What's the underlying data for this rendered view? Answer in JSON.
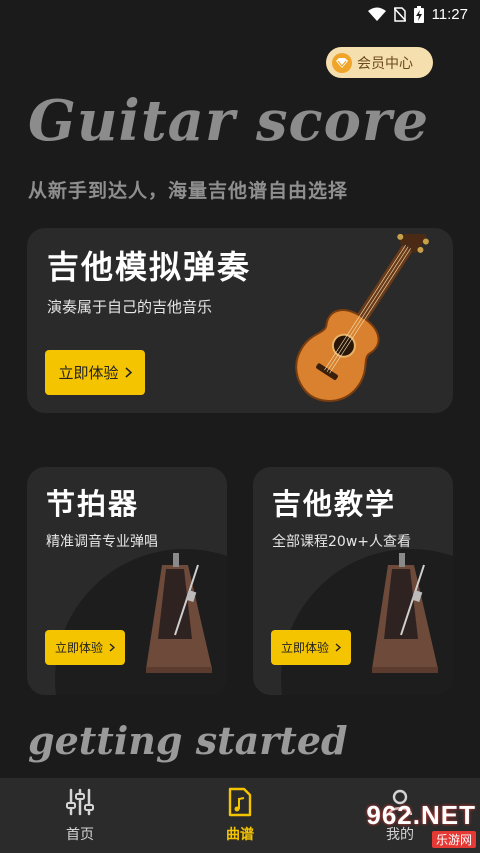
{
  "status_bar": {
    "time": "11:27"
  },
  "vip_button": {
    "label": "会员中心"
  },
  "hero": {
    "title": "Guitar score",
    "subtitle": "从新手到达人，海量吉他谱自由选择"
  },
  "cards": {
    "guitar_sim": {
      "title": "吉他模拟弹奏",
      "description": "演奏属于自己的吉他音乐",
      "button": "立即体验"
    },
    "metronome": {
      "title": "节拍器",
      "description": "精准调音专业弹唱",
      "button": "立即体验"
    },
    "guitar_teaching": {
      "title": "吉他教学",
      "description": "全部课程20w+人查看",
      "button": "立即体验"
    }
  },
  "footer": {
    "title": "getting started"
  },
  "tabbar": {
    "tabs": [
      {
        "label": "首页",
        "icon": "sliders-icon",
        "active": false
      },
      {
        "label": "曲谱",
        "icon": "music-file-icon",
        "active": true
      },
      {
        "label": "我的",
        "icon": "user-icon",
        "active": false
      }
    ]
  },
  "watermark": {
    "main": "962.NET",
    "sub": "乐游网"
  },
  "colors": {
    "accent": "#f5c400",
    "background": "#1b1b1b",
    "card": "#2a2a2a",
    "vip": "#f6dfae"
  }
}
